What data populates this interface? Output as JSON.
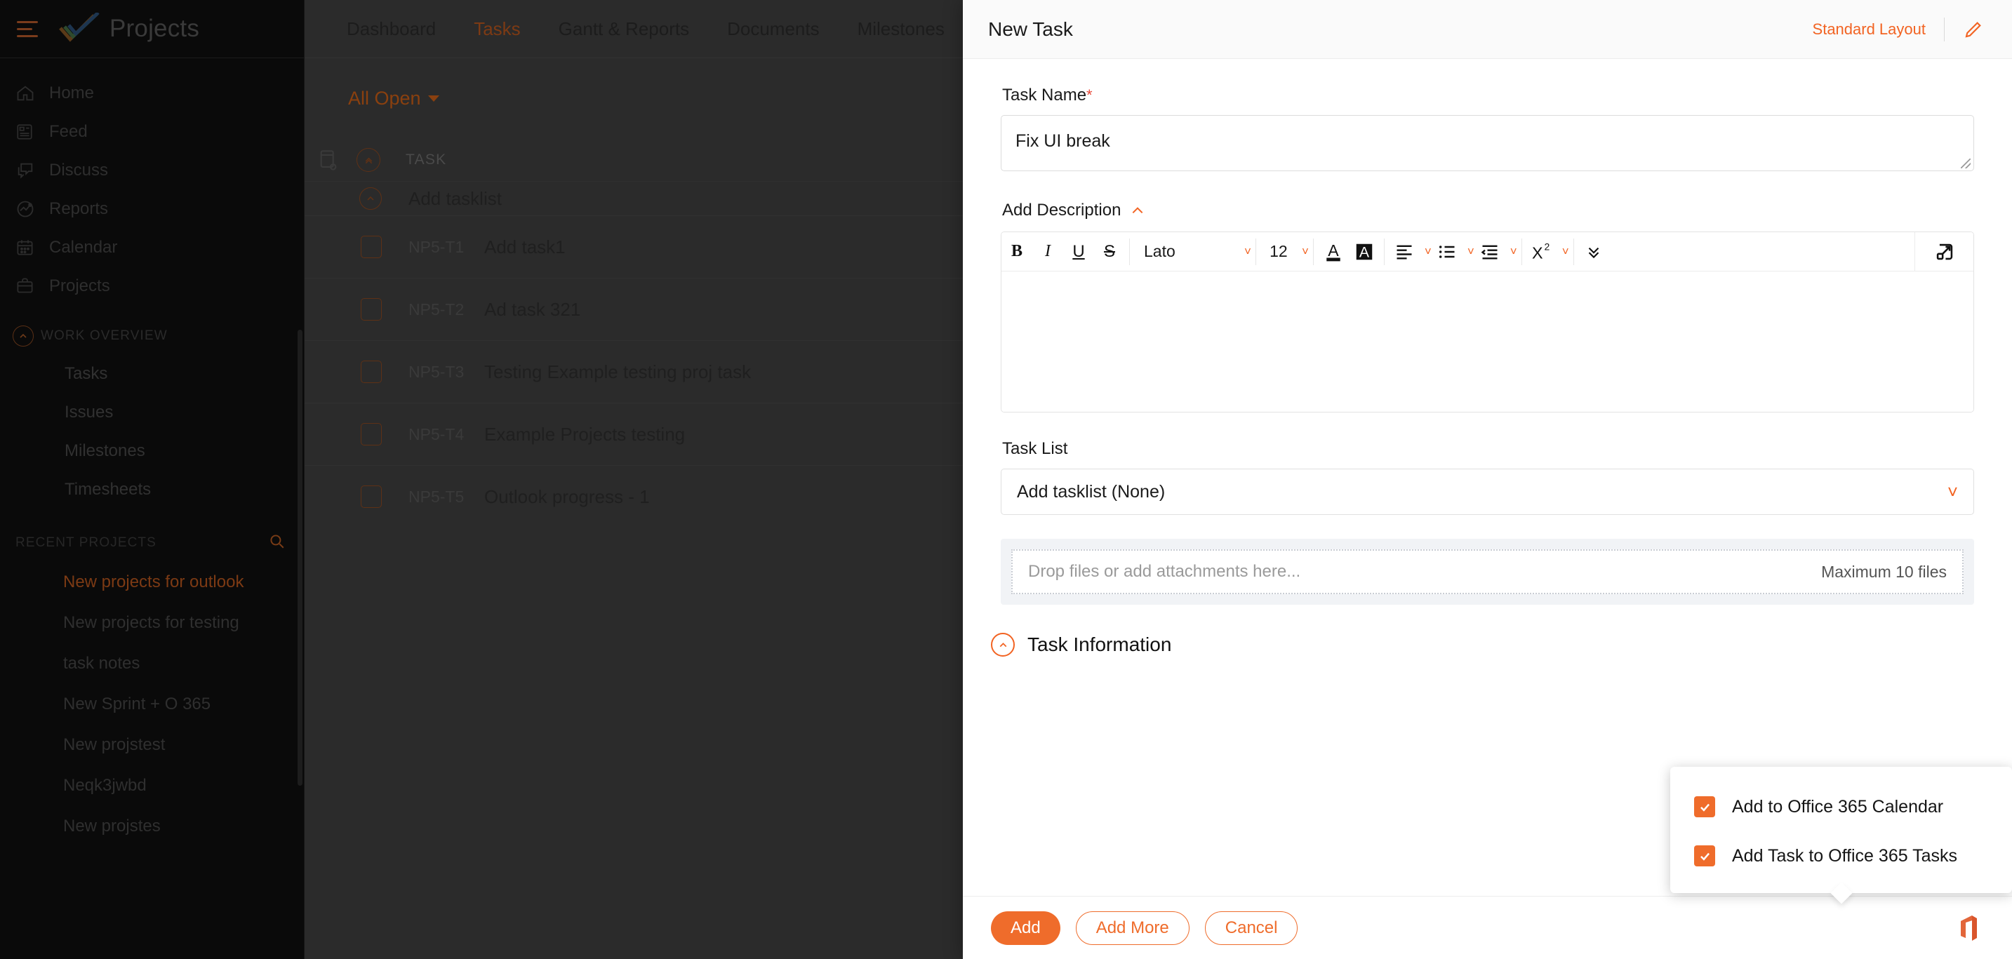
{
  "brand": {
    "title": "Projects",
    "hamburger_icon": "hamburger-icon",
    "logo_icon": "zoho-projects-check-logo"
  },
  "sidebar": {
    "nav": [
      {
        "label": "Home",
        "icon": "home-icon"
      },
      {
        "label": "Feed",
        "icon": "feed-icon"
      },
      {
        "label": "Discuss",
        "icon": "discuss-icon"
      },
      {
        "label": "Reports",
        "icon": "reports-icon"
      },
      {
        "label": "Calendar",
        "icon": "calendar-icon"
      },
      {
        "label": "Projects",
        "icon": "briefcase-icon"
      }
    ],
    "work_overview": {
      "title": "WORK OVERVIEW",
      "collapse_icon": "chevron-up-circle-icon",
      "items": [
        {
          "label": "Tasks"
        },
        {
          "label": "Issues"
        },
        {
          "label": "Milestones"
        },
        {
          "label": "Timesheets"
        }
      ]
    },
    "recent_projects": {
      "title": "RECENT PROJECTS",
      "search_icon": "search-icon",
      "items": [
        {
          "label": "New projects for outlook",
          "active": true
        },
        {
          "label": "New projects for testing",
          "active": false
        },
        {
          "label": "task notes",
          "active": false
        },
        {
          "label": "New Sprint + O 365",
          "active": false
        },
        {
          "label": "New projstest",
          "active": false
        },
        {
          "label": "Neqk3jwbd",
          "active": false
        },
        {
          "label": "New projstes",
          "active": false
        }
      ]
    }
  },
  "topbar": {
    "tabs": [
      {
        "label": "Dashboard",
        "active": false
      },
      {
        "label": "Tasks",
        "active": true
      },
      {
        "label": "Gantt & Reports",
        "active": false
      },
      {
        "label": "Documents",
        "active": false
      },
      {
        "label": "Milestones",
        "active": false
      }
    ]
  },
  "tasks_view": {
    "filter_label": "All Open",
    "filter_caret_icon": "caret-down-icon",
    "grid_settings_icon": "grid-settings-icon",
    "collapse_all_icon": "chevron-up-circle-icon",
    "column_header": "TASK",
    "tasklist_row": {
      "label": "Add tasklist",
      "icon": "chevron-up-circle-icon"
    },
    "rows": [
      {
        "code": "NP5-T1",
        "title": "Add task1"
      },
      {
        "code": "NP5-T2",
        "title": "Ad task 321"
      },
      {
        "code": "NP5-T3",
        "title": "Testing Example testing proj task"
      },
      {
        "code": "NP5-T4",
        "title": "Example Projects testing"
      },
      {
        "code": "NP5-T5",
        "title": "Outlook progress - 1"
      }
    ]
  },
  "modal": {
    "title": "New Task",
    "layout_link": "Standard Layout",
    "edit_icon": "pencil-icon",
    "task_name": {
      "label": "Task Name",
      "required_marker": "*",
      "value": "Fix UI break",
      "resize_handle_icon": "resize-grip-icon"
    },
    "description": {
      "label": "Add Description",
      "collapse_icon": "chevron-up-icon",
      "body_text": "",
      "toolbar": {
        "bold": "B",
        "italic": "I",
        "underline": "U",
        "strikethrough": "S",
        "font_name": "Lato",
        "font_size": "12",
        "font_color_icon": "font-color-icon",
        "highlight_icon": "text-highlight-icon",
        "align_icon": "align-left-icon",
        "list_icon": "bullet-list-icon",
        "indent_icon": "indent-icon",
        "superscript": "X",
        "superscript_exp": "2",
        "more_icon": "chevron-double-down-icon",
        "expand_icon": "expand-editor-icon"
      }
    },
    "task_list": {
      "label": "Task List",
      "value": "Add tasklist (None)",
      "caret_icon": "chevron-down-icon"
    },
    "attachments": {
      "placeholder": "Drop files or add attachments here...",
      "max_note": "Maximum 10 files"
    },
    "task_information": {
      "label": "Task Information",
      "collapse_icon": "chevron-up-circle-icon"
    },
    "footer": {
      "add": "Add",
      "add_more": "Add More",
      "cancel": "Cancel",
      "office_icon": "office-365-icon"
    }
  },
  "office_menu": {
    "items": [
      {
        "label": "Add to Office 365 Calendar",
        "checked": true
      },
      {
        "label": "Add Task to Office 365 Tasks",
        "checked": true
      }
    ],
    "check_icon": "checkmark-icon"
  },
  "colors": {
    "accent": "#f26322",
    "accent_button": "#ef6c2b",
    "required": "#e8493a",
    "sidebar_bg": "#0a0a0a",
    "app_bg": "#2b2b2b",
    "modal_bg": "#ffffff"
  }
}
